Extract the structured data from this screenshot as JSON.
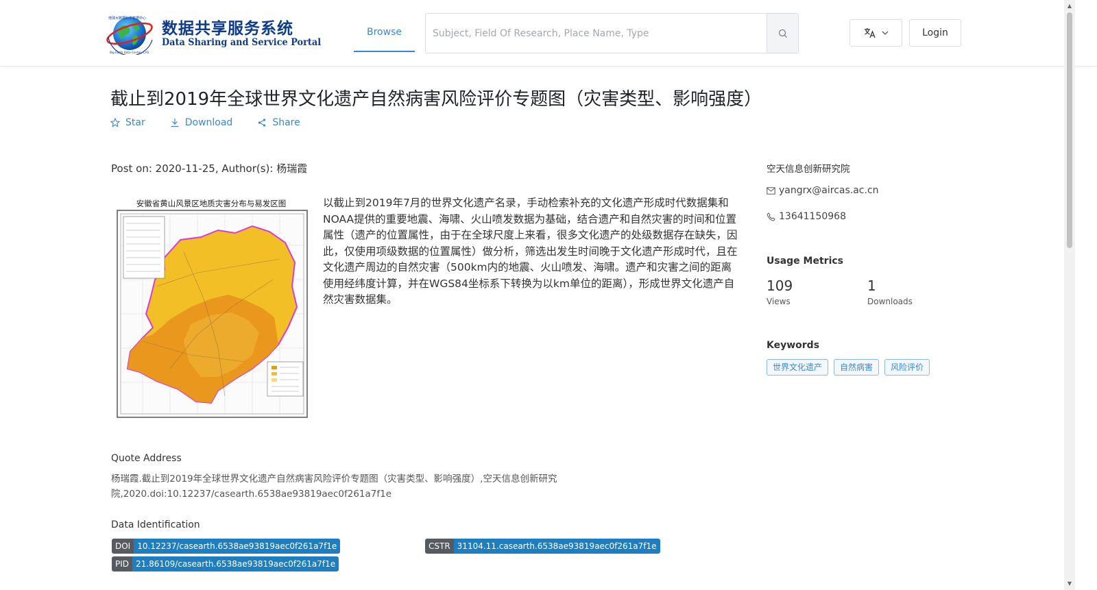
{
  "header": {
    "logo_cn": "数据共享服务系统",
    "logo_en": "Data Sharing and Service Portal",
    "logo_ring_text": "地球大数据科学数据中心",
    "logo_ring_text_en": "Big Earth Data Center, CAS",
    "nav_browse": "Browse",
    "search_placeholder": "Subject, Field Of Research, Place Name, Type",
    "login": "Login"
  },
  "dataset": {
    "title": "截止到2019年全球世界文化遗产自然病害风险评价专题图（灾害类型、影响强度）",
    "actions": {
      "star": "Star",
      "download": "Download",
      "share": "Share"
    },
    "post_info": "Post on: 2020-11-25, Author(s): 杨瑞霞",
    "thumbnail_title": "安徽省黄山风景区地质灾害分布与易发区图",
    "description": "以截止到2019年7月的世界文化遗产名录，手动检索补充的文化遗产形成时代数据集和NOAA提供的重要地震、海啸、火山喷发数据为基础，结合遗产和自然灾害的时间和位置属性（遗产的位置属性，由于在全球尺度上来看，很多文化遗产的处级数据存在缺失，因此，仅使用项级数据的位置属性）做分析，筛选出发生时间晚于文化遗产形成时代，且在文化遗产周边的自然灾害（500km内的地震、火山喷发、海啸。遗产和灾害之间的距离使用经纬度计算，并在WGS84坐标系下转换为以km单位的距离），形成世界文化遗产自然灾害数据集。",
    "quote_label": "Quote Address",
    "quote_text": "杨瑞霞.截止到2019年全球世界文化遗产自然病害风险评价专题图（灾害类型、影响强度）,空天信息创新研究院,2020.doi:10.12237/casearth.6538ae93819aec0f261a7f1e",
    "identification_label": "Data Identification",
    "identifiers": {
      "doi": {
        "key": "DOI",
        "value": "10.12237/casearth.6538ae93819aec0f261a7f1e"
      },
      "cstr": {
        "key": "CSTR",
        "value": "31104.11.casearth.6538ae93819aec0f261a7f1e"
      },
      "pid": {
        "key": "PID",
        "value": "21.86109/casearth.6538ae93819aec0f261a7f1e"
      }
    }
  },
  "sidebar": {
    "organization": "空天信息创新研究院",
    "email": "yangrx@aircas.ac.cn",
    "phone": "13641150968",
    "usage_heading": "Usage Metrics",
    "views_count": "109",
    "views_label": "Views",
    "downloads_count": "1",
    "downloads_label": "Downloads",
    "keywords_heading": "Keywords",
    "keywords": [
      "世界文化遗产",
      "自然病害",
      "风险评价"
    ]
  },
  "colors": {
    "accent": "#3a86d6",
    "badge_key": "#555b61",
    "badge_value": "#1d7fc1",
    "logo_blue": "#0f3b8c"
  }
}
